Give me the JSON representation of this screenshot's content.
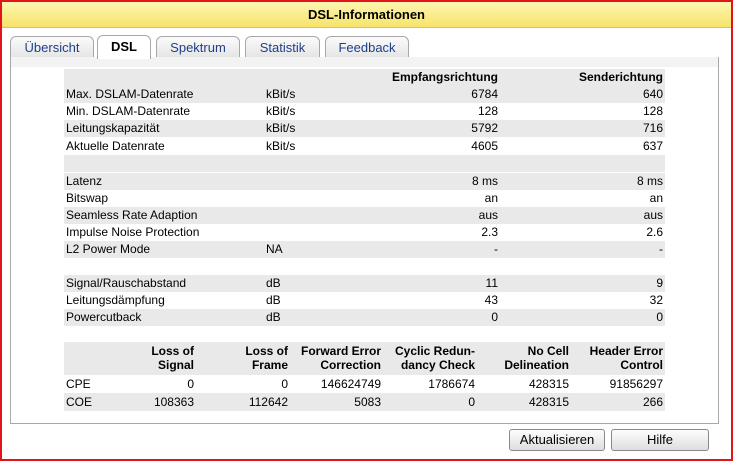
{
  "window": {
    "title": "DSL-Informationen"
  },
  "tabs": [
    {
      "label": "Übersicht"
    },
    {
      "label": "DSL"
    },
    {
      "label": "Spektrum"
    },
    {
      "label": "Statistik"
    },
    {
      "label": "Feedback"
    }
  ],
  "dsl_table": {
    "headers": {
      "rx": "Empfangsrichtung",
      "tx": "Senderichtung"
    },
    "rows": [
      {
        "label": "Max. DSLAM-Datenrate",
        "unit": "kBit/s",
        "rx": "6784",
        "tx": "640"
      },
      {
        "label": "Min. DSLAM-Datenrate",
        "unit": "kBit/s",
        "rx": "128",
        "tx": "128"
      },
      {
        "label": "Leitungskapazität",
        "unit": "kBit/s",
        "rx": "5792",
        "tx": "716"
      },
      {
        "label": "Aktuelle Datenrate",
        "unit": "kBit/s",
        "rx": "4605",
        "tx": "637"
      },
      {
        "label": "Latenz",
        "unit": "",
        "rx": "8 ms",
        "tx": "8 ms"
      },
      {
        "label": "Bitswap",
        "unit": "",
        "rx": "an",
        "tx": "an"
      },
      {
        "label": "Seamless Rate Adaption",
        "unit": "",
        "rx": "aus",
        "tx": "aus"
      },
      {
        "label": "Impulse Noise Protection",
        "unit": "",
        "rx": "2.3",
        "tx": "2.6"
      },
      {
        "label": "L2 Power Mode",
        "unit": "NA",
        "rx": "-",
        "tx": "-"
      },
      {
        "label": "Signal/Rauschabstand",
        "unit": "dB",
        "rx": "11",
        "tx": "9"
      },
      {
        "label": "Leitungsdämpfung",
        "unit": "dB",
        "rx": "43",
        "tx": "32"
      },
      {
        "label": "Powercutback",
        "unit": "dB",
        "rx": "0",
        "tx": "0"
      }
    ]
  },
  "error_table": {
    "columns": [
      {
        "line1": "Loss of",
        "line2": "Signal"
      },
      {
        "line1": "Loss of",
        "line2": "Frame"
      },
      {
        "line1": "Forward Error",
        "line2": "Correction"
      },
      {
        "line1": "Cyclic Redun-",
        "line2": "dancy Check"
      },
      {
        "line1": "No Cell",
        "line2": "Delineation"
      },
      {
        "line1": "Header Error",
        "line2": "Control"
      }
    ],
    "rows": [
      {
        "label": "CPE",
        "values": [
          "0",
          "0",
          "146624749",
          "1786674",
          "428315",
          "91856297"
        ]
      },
      {
        "label": "COE",
        "values": [
          "108363",
          "112642",
          "5083",
          "0",
          "428315",
          "266"
        ]
      }
    ]
  },
  "buttons": {
    "refresh": "Aktualisieren",
    "help": "Hilfe"
  }
}
